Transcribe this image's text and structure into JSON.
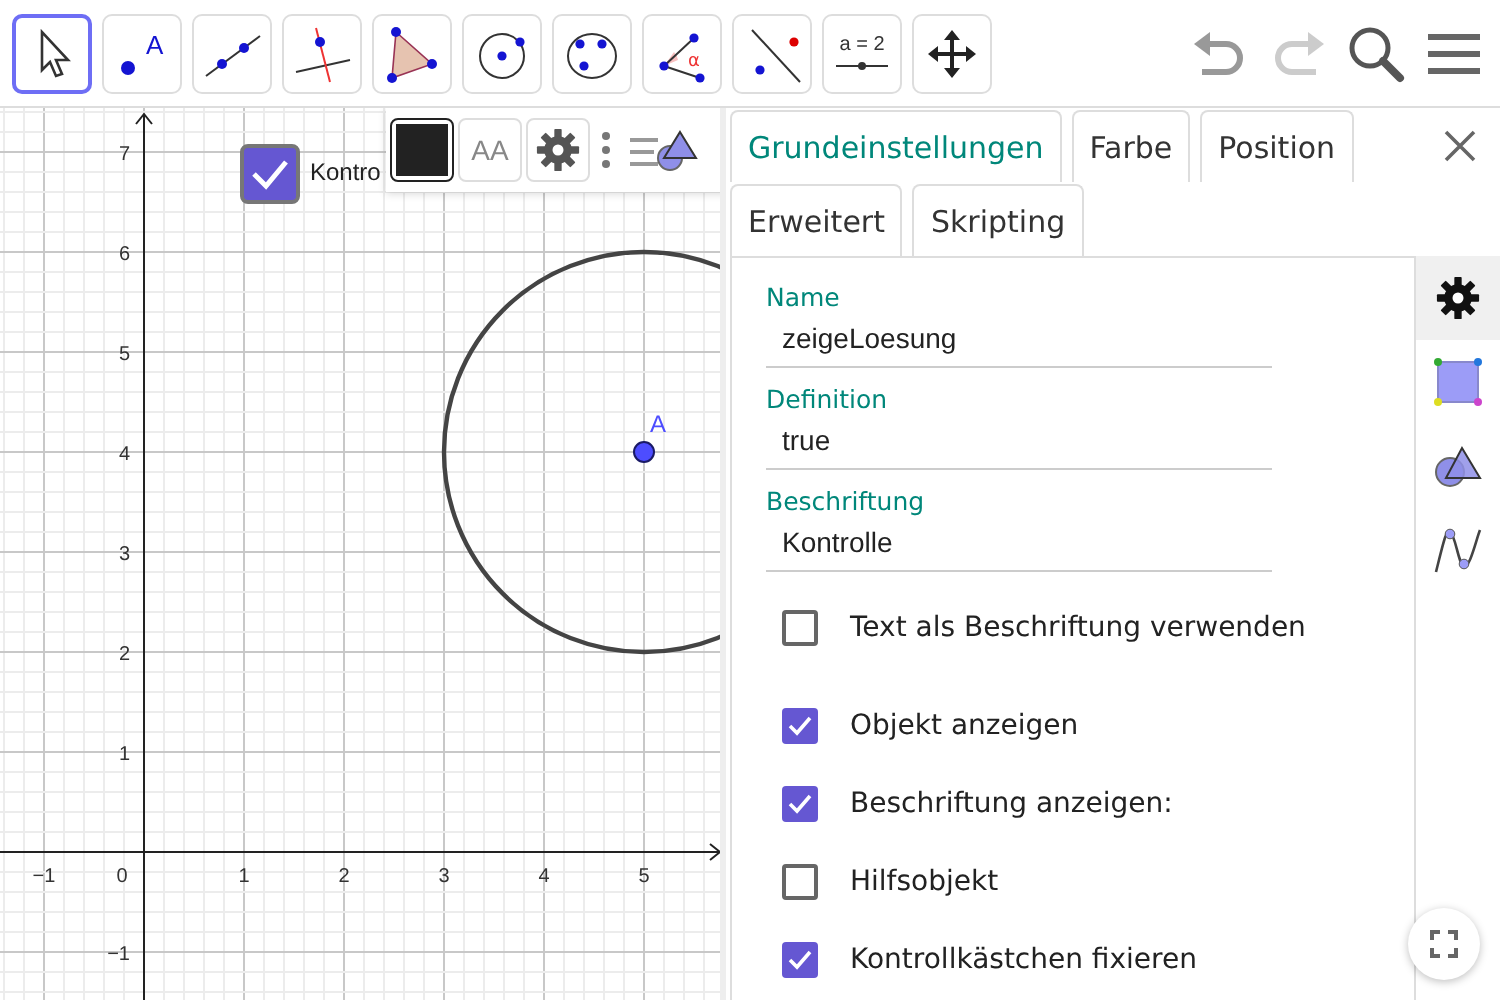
{
  "toolbar": {
    "tools": [
      {
        "kind": "move",
        "selected": true
      },
      {
        "kind": "point",
        "label": "A",
        "selected": false
      },
      {
        "kind": "line",
        "selected": false
      },
      {
        "kind": "perpendicular",
        "selected": false
      },
      {
        "kind": "polygon",
        "selected": false
      },
      {
        "kind": "circle-center",
        "selected": false
      },
      {
        "kind": "circle-three",
        "selected": false
      },
      {
        "kind": "angle",
        "label": "α",
        "selected": false
      },
      {
        "kind": "reflect",
        "selected": false
      },
      {
        "kind": "slider",
        "label": "a = 2",
        "selected": false
      },
      {
        "kind": "move-view",
        "selected": false
      }
    ],
    "actions": [
      {
        "kind": "undo",
        "disabled": false
      },
      {
        "kind": "redo",
        "disabled": true
      },
      {
        "kind": "search"
      },
      {
        "kind": "menu"
      }
    ]
  },
  "graphics": {
    "checkbox": {
      "label": "Kontro",
      "checked": true
    },
    "point": {
      "label": "A"
    },
    "x_axis_labels": [
      "−1",
      "0",
      "1",
      "2",
      "3",
      "4",
      "5"
    ],
    "y_axis_labels": [
      "7",
      "6",
      "5",
      "4",
      "3",
      "2",
      "1",
      "−1"
    ],
    "style_bar": {
      "text_size": "AA"
    }
  },
  "properties": {
    "tab_rows": [
      [
        {
          "label": "Grundeinstellungen",
          "selected": true
        },
        {
          "label": "Farbe",
          "selected": false
        },
        {
          "label": "Position",
          "selected": false
        }
      ],
      [
        {
          "label": "Erweitert",
          "selected": false
        },
        {
          "label": "Skripting",
          "selected": false
        }
      ]
    ],
    "fields": [
      {
        "label": "Name",
        "value": "zeigeLoesung"
      },
      {
        "label": "Definition",
        "value": "true"
      },
      {
        "label": "Beschriftung",
        "value": "Kontrolle"
      }
    ],
    "checkboxes": [
      {
        "label": "Text als Beschriftung verwenden",
        "checked": false
      },
      {
        "label": "Objekt anzeigen",
        "checked": true
      },
      {
        "label": "Beschriftung anzeigen:",
        "checked": true
      },
      {
        "label": "Hilfsobjekt",
        "checked": false
      },
      {
        "label": "Kontrollkästchen fixieren",
        "checked": true
      }
    ],
    "side_tabs": [
      {
        "kind": "settings",
        "selected": true
      },
      {
        "kind": "polygon",
        "selected": false
      },
      {
        "kind": "shapes",
        "selected": false
      },
      {
        "kind": "function",
        "selected": false
      }
    ]
  }
}
